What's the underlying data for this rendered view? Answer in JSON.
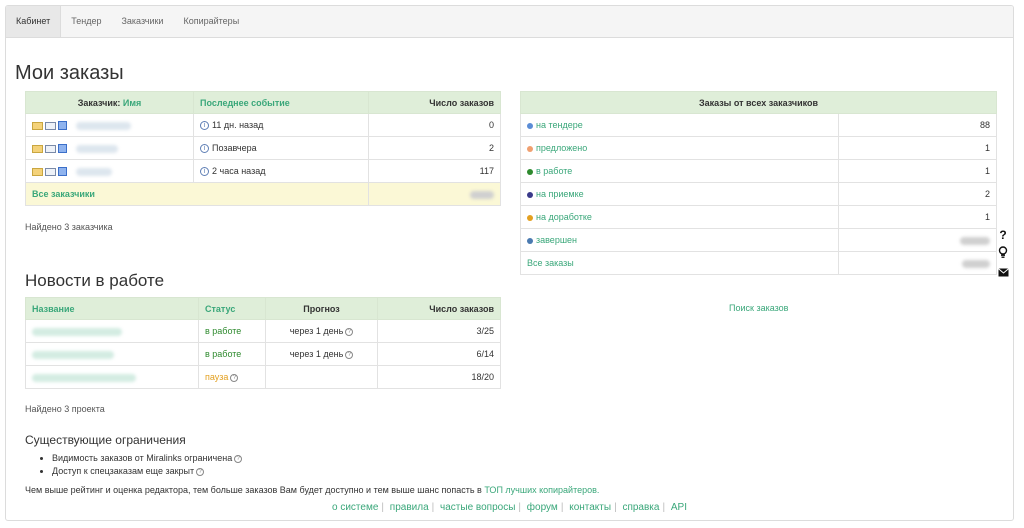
{
  "tabs": [
    {
      "label": "Кабинет",
      "active": true
    },
    {
      "label": "Тендер",
      "active": false
    },
    {
      "label": "Заказчики",
      "active": false
    },
    {
      "label": "Копирайтеры",
      "active": false
    }
  ],
  "my_orders": {
    "title": "Мои заказы",
    "headers": {
      "customer_prefix": "Заказчик:",
      "customer_link": "Имя",
      "last_event": "Последнее событие",
      "orders_count": "Число заказов"
    },
    "rows": [
      {
        "event": "11 дн. назад",
        "count": "0"
      },
      {
        "event": "Позавчера",
        "count": "2"
      },
      {
        "event": "2 часа назад",
        "count": "117"
      }
    ],
    "all_label": "Все заказчики",
    "found": "Найдено 3 заказчика"
  },
  "all_orders": {
    "header": "Заказы от всех заказчиков",
    "rows": [
      {
        "label": "на тендере",
        "value": "88",
        "color": "#5b8dd6"
      },
      {
        "label": "предложено",
        "value": "1",
        "color": "#f0a070"
      },
      {
        "label": "в работе",
        "value": "1",
        "color": "#2e8a2e"
      },
      {
        "label": "на приемке",
        "value": "2",
        "color": "#3a3a8a"
      },
      {
        "label": "на доработке",
        "value": "1",
        "color": "#e3a020"
      },
      {
        "label": "завершен",
        "value": "",
        "color": "#4a7ab0"
      },
      {
        "label": "Все заказы",
        "value": "",
        "color": ""
      }
    ],
    "search_link": "Поиск заказов"
  },
  "news": {
    "title": "Новости в работе",
    "headers": {
      "name": "Название",
      "status": "Статус",
      "forecast": "Прогноз",
      "orders_count": "Число заказов"
    },
    "rows": [
      {
        "status": "в работе",
        "status_kind": "work",
        "forecast": "через 1 день",
        "count": "3/25"
      },
      {
        "status": "в работе",
        "status_kind": "work",
        "forecast": "через 1 день",
        "count": "6/14"
      },
      {
        "status": "пауза",
        "status_kind": "pause",
        "forecast": "",
        "count": "18/20"
      }
    ],
    "found": "Найдено 3 проекта"
  },
  "limits": {
    "title": "Существующие ограничения",
    "items": [
      "Видимость заказов от Miralinks ограничена",
      "Доступ к спецзаказам еще закрыт"
    ],
    "note_text": "Чем выше рейтинг и оценка редактора, тем больше заказов Вам будет доступно и тем выше шанс попасть в",
    "note_link": "ТОП лучших копирайтеров."
  },
  "footer": [
    "о системе",
    "правила",
    "частые вопросы",
    "форум",
    "контакты",
    "справка",
    "API"
  ],
  "side_icons": [
    "question-icon",
    "lightbulb-icon",
    "envelope-icon"
  ],
  "colors": {
    "accent": "#3aa77a",
    "header_bg": "#dfeed9",
    "highlight_row": "#fbf8d6"
  }
}
